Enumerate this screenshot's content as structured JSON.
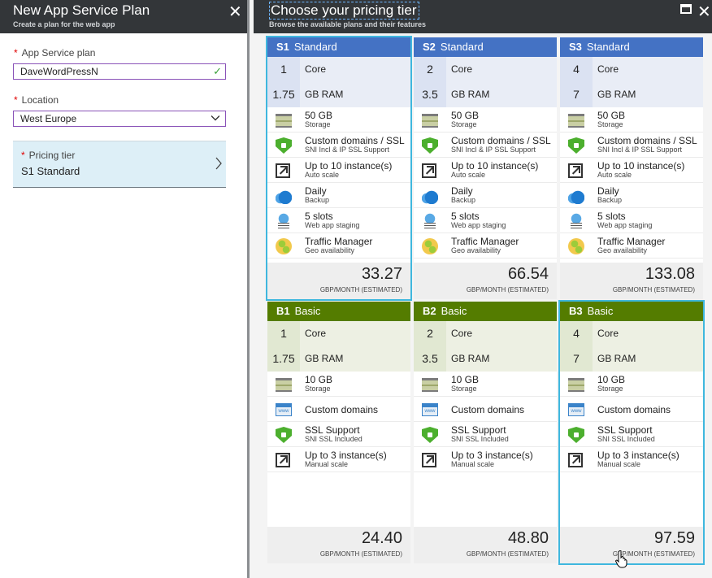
{
  "left": {
    "title": "New App Service Plan",
    "subtitle": "Create a plan for the web app",
    "close": "✕",
    "plan_label": "App Service plan",
    "plan_value": "DaveWordPressN",
    "location_label": "Location",
    "location_value": "West Europe",
    "pricing_label": "Pricing tier",
    "pricing_value": "S1 Standard",
    "required_mark": "*",
    "check": "✓"
  },
  "right": {
    "title": "Choose your pricing tier",
    "subtitle": "Browse the available plans and their features",
    "close": "✕"
  },
  "price_unit": "GBP/MONTH (ESTIMATED)",
  "tiers": [
    {
      "code": "S1",
      "name": "Standard",
      "cores": "1",
      "core_label": "Core",
      "ram": "1.75",
      "ram_label": "GB RAM",
      "features": [
        {
          "title": "50 GB",
          "sub": "Storage"
        },
        {
          "title": "Custom domains / SSL",
          "sub": "SNI Incl & IP SSL Support"
        },
        {
          "title": "Up to 10 instance(s)",
          "sub": "Auto scale"
        },
        {
          "title": "Daily",
          "sub": "Backup"
        },
        {
          "title": "5 slots",
          "sub": "Web app staging"
        },
        {
          "title": "Traffic Manager",
          "sub": "Geo availability"
        }
      ],
      "price": "33.27"
    },
    {
      "code": "S2",
      "name": "Standard",
      "cores": "2",
      "core_label": "Core",
      "ram": "3.5",
      "ram_label": "GB RAM",
      "features": [
        {
          "title": "50 GB",
          "sub": "Storage"
        },
        {
          "title": "Custom domains / SSL",
          "sub": "SNI Incl & IP SSL Support"
        },
        {
          "title": "Up to 10 instance(s)",
          "sub": "Auto scale"
        },
        {
          "title": "Daily",
          "sub": "Backup"
        },
        {
          "title": "5 slots",
          "sub": "Web app staging"
        },
        {
          "title": "Traffic Manager",
          "sub": "Geo availability"
        }
      ],
      "price": "66.54"
    },
    {
      "code": "S3",
      "name": "Standard",
      "cores": "4",
      "core_label": "Core",
      "ram": "7",
      "ram_label": "GB RAM",
      "features": [
        {
          "title": "50 GB",
          "sub": "Storage"
        },
        {
          "title": "Custom domains / SSL",
          "sub": "SNI Incl & IP SSL Support"
        },
        {
          "title": "Up to 10 instance(s)",
          "sub": "Auto scale"
        },
        {
          "title": "Daily",
          "sub": "Backup"
        },
        {
          "title": "5 slots",
          "sub": "Web app staging"
        },
        {
          "title": "Traffic Manager",
          "sub": "Geo availability"
        }
      ],
      "price": "133.08"
    },
    {
      "code": "B1",
      "name": "Basic",
      "cores": "1",
      "core_label": "Core",
      "ram": "1.75",
      "ram_label": "GB RAM",
      "features": [
        {
          "title": "10 GB",
          "sub": "Storage"
        },
        {
          "title": "Custom domains",
          "sub": ""
        },
        {
          "title": "SSL Support",
          "sub": "SNI SSL Included"
        },
        {
          "title": "Up to 3 instance(s)",
          "sub": "Manual scale"
        }
      ],
      "price": "24.40"
    },
    {
      "code": "B2",
      "name": "Basic",
      "cores": "2",
      "core_label": "Core",
      "ram": "3.5",
      "ram_label": "GB RAM",
      "features": [
        {
          "title": "10 GB",
          "sub": "Storage"
        },
        {
          "title": "Custom domains",
          "sub": ""
        },
        {
          "title": "SSL Support",
          "sub": "SNI SSL Included"
        },
        {
          "title": "Up to 3 instance(s)",
          "sub": "Manual scale"
        }
      ],
      "price": "48.80"
    },
    {
      "code": "B3",
      "name": "Basic",
      "cores": "4",
      "core_label": "Core",
      "ram": "7",
      "ram_label": "GB RAM",
      "features": [
        {
          "title": "10 GB",
          "sub": "Storage"
        },
        {
          "title": "Custom domains",
          "sub": ""
        },
        {
          "title": "SSL Support",
          "sub": "SNI SSL Included"
        },
        {
          "title": "Up to 3 instance(s)",
          "sub": "Manual scale"
        }
      ],
      "price": "97.59"
    }
  ],
  "colors": {
    "standard": "#4472c4",
    "basic": "#547c00",
    "selected_outline": "#3fb7de",
    "header": "#333639"
  },
  "selected_tiers": [
    "S1",
    "B3"
  ]
}
